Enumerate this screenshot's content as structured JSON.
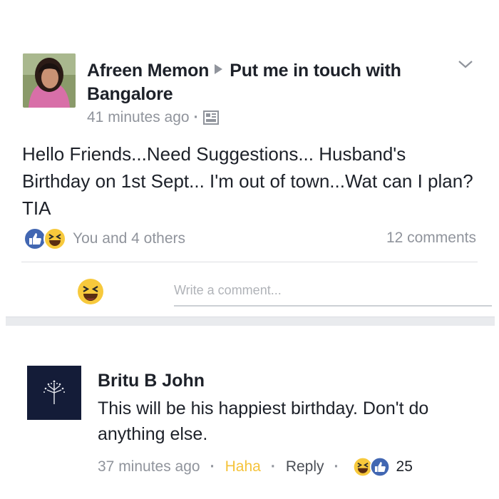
{
  "post": {
    "author": "Afreen Memon",
    "target_group": "Put me in touch with Bangalore",
    "timestamp": "41 minutes ago",
    "privacy_icon": "image-icon",
    "text": "Hello Friends...Need Suggestions... Husband's Birthday on 1st Sept... I'm out of town...Wat can I plan? TIA",
    "reactions_text": "You and 4 others",
    "comments_text": "12 comments",
    "write_placeholder": "Write a comment..."
  },
  "comment": {
    "author": "Britu B John",
    "text": "This will be his happiest birthday. Don't do anything else.",
    "timestamp": "37 minutes ago",
    "haha_label": "Haha",
    "reply_label": "Reply",
    "reaction_count": "25"
  },
  "colors": {
    "like_blue": "#3b5998",
    "haha_yellow": "#f5c33b",
    "muted": "#90949c"
  }
}
